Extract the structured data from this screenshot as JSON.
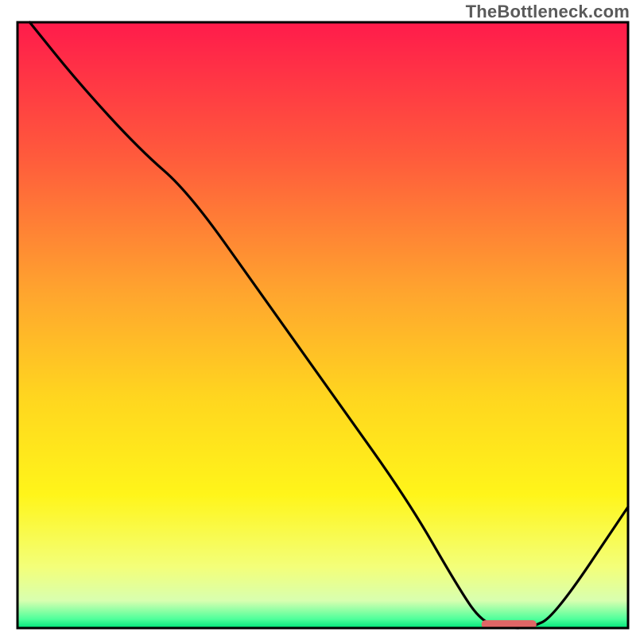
{
  "watermark": "TheBottleneck.com",
  "chart_data": {
    "type": "line",
    "title": "",
    "xlabel": "",
    "ylabel": "",
    "xlim": [
      0,
      100
    ],
    "ylim": [
      0,
      100
    ],
    "grid": false,
    "legend": false,
    "background_gradient_stops": [
      {
        "offset": 0.0,
        "color": "#ff1b4b"
      },
      {
        "offset": 0.22,
        "color": "#ff5a3c"
      },
      {
        "offset": 0.45,
        "color": "#ffa62e"
      },
      {
        "offset": 0.62,
        "color": "#ffd61f"
      },
      {
        "offset": 0.78,
        "color": "#fff51a"
      },
      {
        "offset": 0.9,
        "color": "#f3ff7a"
      },
      {
        "offset": 0.955,
        "color": "#d8ffb0"
      },
      {
        "offset": 0.985,
        "color": "#4fff9b"
      },
      {
        "offset": 1.0,
        "color": "#00e57a"
      }
    ],
    "series": [
      {
        "name": "bottleneck-curve",
        "color": "#000000",
        "x": [
          2,
          10,
          20,
          28,
          40,
          52,
          64,
          72,
          76,
          80,
          84,
          88,
          100
        ],
        "y": [
          100,
          90,
          79,
          72,
          55,
          38,
          21,
          7,
          1,
          0,
          0,
          2,
          20
        ]
      }
    ],
    "marker": {
      "name": "optimal-range-marker",
      "color": "#e06666",
      "x_start": 76,
      "x_end": 85,
      "y": 0.6,
      "thickness_pct": 1.4
    },
    "frame": {
      "color": "#000000",
      "stroke": 3
    }
  }
}
